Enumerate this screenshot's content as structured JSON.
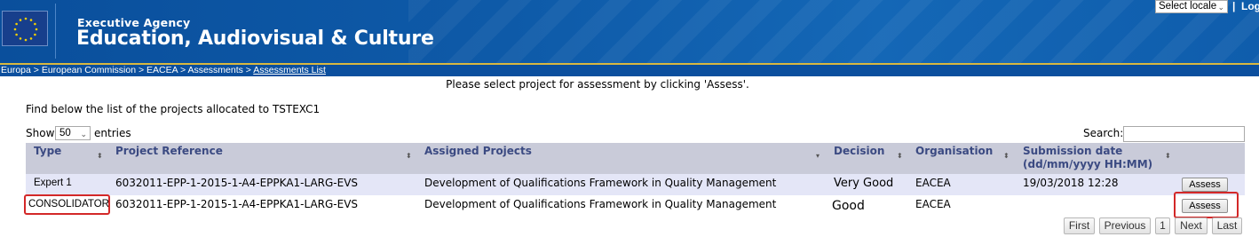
{
  "header": {
    "agency_small": "Executive Agency",
    "agency_big": "Education, Audiovisual & Culture",
    "locale_select": "Select locale",
    "separator": "|",
    "logout_partial": "Log"
  },
  "breadcrumb": {
    "items": [
      "Europa",
      "European Commission",
      "EACEA",
      "Assessments",
      "Assessments List"
    ],
    "separator": " > "
  },
  "instruction": "Please select project for assessment by clicking 'Assess'.",
  "intro": "Find below the list of the projects allocated to TSTEXC1",
  "length_control": {
    "show_label": "Show",
    "value": "50",
    "entries_label": "entries"
  },
  "search": {
    "label": "Search:",
    "value": ""
  },
  "table": {
    "columns": [
      {
        "label": "Type",
        "sort": "⬍"
      },
      {
        "label": "Project Reference",
        "sort": "⬍"
      },
      {
        "label": "Assigned Projects",
        "sort": "▾"
      },
      {
        "label": "Decision",
        "sort": "⬍"
      },
      {
        "label": "Organisation",
        "sort": "⬍"
      },
      {
        "label": "Submission date\n(dd/mm/yyyy HH:MM)",
        "sort": "⬍"
      }
    ],
    "rows": [
      {
        "type": "Expert 1",
        "reference": "6032011-EPP-1-2015-1-A4-EPPKA1-LARG-EVS",
        "project": "Development of Qualifications Framework in Quality Management",
        "decision": "Very Good",
        "organisation": "EACEA",
        "submission_date": "19/03/2018 12:28",
        "action": "Assess"
      },
      {
        "type": "CONSOLIDATOR",
        "reference": "6032011-EPP-1-2015-1-A4-EPPKA1-LARG-EVS",
        "project": "Development of Qualifications Framework in Quality Management",
        "decision": "Good",
        "organisation": "EACEA",
        "submission_date": "",
        "action": "Assess"
      }
    ]
  },
  "pagination": {
    "first": "First",
    "previous": "Previous",
    "current": "1",
    "next": "Next",
    "last": "Last"
  },
  "colors": {
    "banner": "#0e5aa8",
    "header_row": "#c9cbd9",
    "header_text": "#3b4a82",
    "odd_row": "#e4e6f7",
    "highlight": "#d32828",
    "gold": "#d8b740"
  },
  "icons": {
    "logo": "eu-flag-icon",
    "sort": "sort-arrows-icon",
    "dropdown": "chevron-down-icon"
  }
}
